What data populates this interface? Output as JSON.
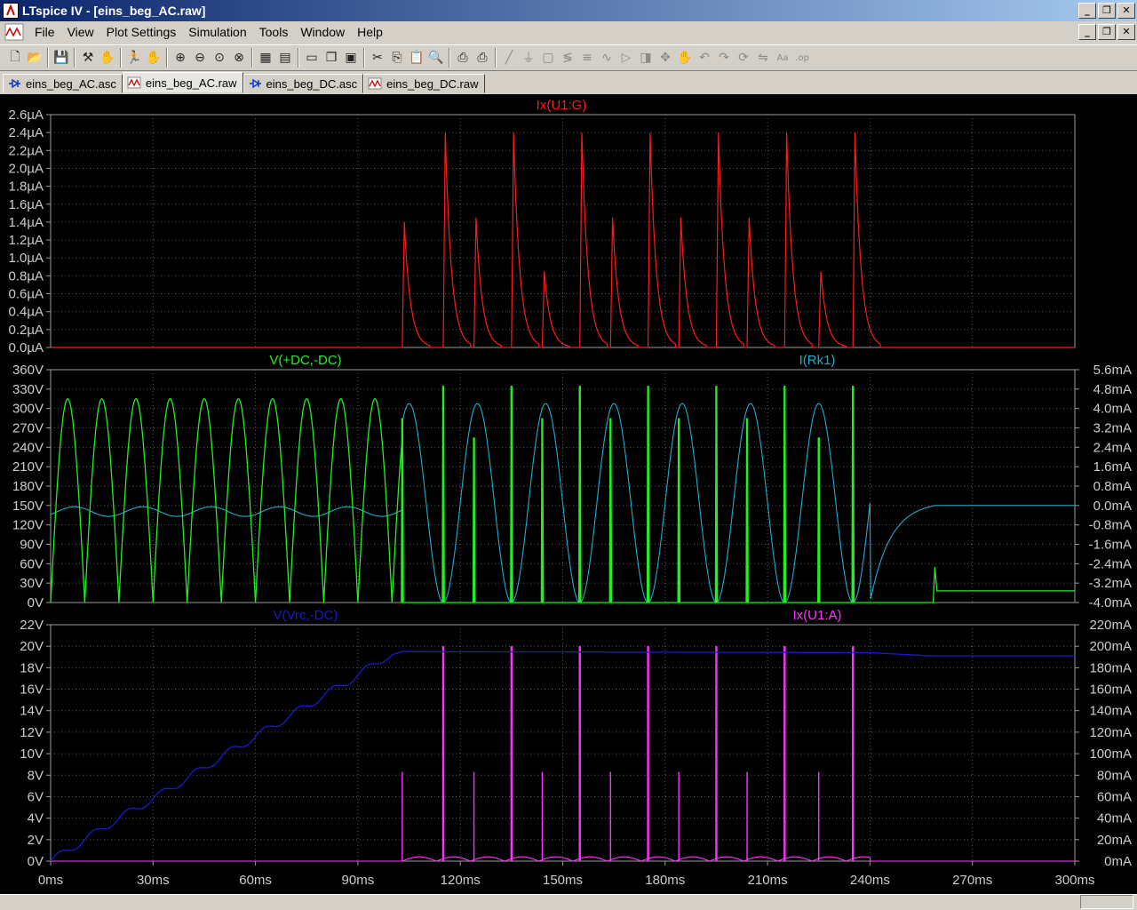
{
  "window": {
    "title": "LTspice IV - [eins_beg_AC.raw]",
    "controls": [
      "minimize",
      "restore",
      "close"
    ]
  },
  "menu": [
    "File",
    "View",
    "Plot Settings",
    "Simulation",
    "Tools",
    "Window",
    "Help"
  ],
  "toolbar": [
    "new-schematic-icon",
    "open-icon",
    "|",
    "save-icon",
    "|",
    "hammer-icon",
    "pan-icon",
    "|",
    "run-icon",
    "halt-icon",
    "|",
    "zoom-in-icon",
    "zoom-out-icon",
    "zoom-fit-icon",
    "zoom-cancel-icon",
    "|",
    "autoscale-icon",
    "tile-icon",
    "|",
    "cascade-icon",
    "tile-vertical-icon",
    "window-icon",
    "|",
    "cut-icon",
    "copy-icon",
    "paste-icon",
    "find-icon",
    "|",
    "print-icon",
    "print-setup-icon",
    "|",
    "wire-icon",
    "ground-icon",
    "label-icon",
    "resistor-icon",
    "capacitor-icon",
    "inductor-icon",
    "diode-icon",
    "component-icon",
    "move-icon",
    "drag-icon",
    "undo-icon",
    "redo-icon",
    "rotate-icon",
    "mirror-icon",
    "text-icon",
    "spice-directive-icon"
  ],
  "tabs": [
    {
      "label": "eins_beg_AC.asc",
      "kind": "schematic",
      "active": false
    },
    {
      "label": "eins_beg_AC.raw",
      "kind": "waveform",
      "active": true
    },
    {
      "label": "eins_beg_DC.asc",
      "kind": "schematic",
      "active": false
    },
    {
      "label": "eins_beg_DC.raw",
      "kind": "waveform",
      "active": false
    }
  ],
  "colors": {
    "background": "#000000",
    "grid": "#5a5a5a",
    "axis_text": "#cccccc",
    "red": "#ff1a1a",
    "green": "#22ee22",
    "cyan": "#22aacc",
    "blue": "#1a1acc",
    "magenta": "#ff33ff"
  },
  "chart_data": [
    {
      "type": "line",
      "title": "",
      "xlim": [
        0,
        300
      ],
      "xunit": "ms",
      "x_ticks": [
        "0ms",
        "30ms",
        "60ms",
        "90ms",
        "120ms",
        "150ms",
        "180ms",
        "210ms",
        "240ms",
        "270ms",
        "300ms"
      ],
      "left_axis": {
        "unit": "µA",
        "ylim": [
          0,
          2.6
        ],
        "ticks": [
          "0.0µA",
          "0.2µA",
          "0.4µA",
          "0.6µA",
          "0.8µA",
          "1.0µA",
          "1.2µA",
          "1.4µA",
          "1.6µA",
          "1.8µA",
          "2.0µA",
          "2.2µA",
          "2.4µA",
          "2.6µA"
        ]
      },
      "series": [
        {
          "name": "Ix(U1:G)",
          "color": "red",
          "axis": "left",
          "pulses": [
            {
              "t": 103,
              "peak": 1.4
            },
            {
              "t": 115,
              "peak": 2.4
            },
            {
              "t": 124,
              "peak": 1.45
            },
            {
              "t": 135,
              "peak": 2.4
            },
            {
              "t": 144,
              "peak": 0.85
            },
            {
              "t": 155,
              "peak": 2.4
            },
            {
              "t": 164,
              "peak": 1.45
            },
            {
              "t": 175,
              "peak": 2.4
            },
            {
              "t": 184,
              "peak": 1.45
            },
            {
              "t": 195,
              "peak": 2.4
            },
            {
              "t": 204,
              "peak": 1.45
            },
            {
              "t": 215,
              "peak": 2.4
            },
            {
              "t": 225,
              "peak": 0.85
            },
            {
              "t": 235,
              "peak": 2.4
            }
          ]
        }
      ]
    },
    {
      "type": "line",
      "title": "",
      "xlim": [
        0,
        300
      ],
      "left_axis": {
        "unit": "V",
        "ylim": [
          0,
          360
        ],
        "ticks": [
          "0V",
          "30V",
          "60V",
          "90V",
          "120V",
          "150V",
          "180V",
          "210V",
          "240V",
          "270V",
          "300V",
          "330V",
          "360V"
        ]
      },
      "right_axis": {
        "unit": "mA",
        "ylim": [
          -4.0,
          5.6
        ],
        "ticks": [
          "-4.0mA",
          "-3.2mA",
          "-2.4mA",
          "-1.6mA",
          "-0.8mA",
          "0.0mA",
          "0.8mA",
          "1.6mA",
          "2.4mA",
          "3.2mA",
          "4.0mA",
          "4.8mA",
          "5.6mA"
        ]
      },
      "series": [
        {
          "name": "V(+DC,-DC)",
          "color": "green",
          "axis": "left",
          "peak": 315,
          "period_ms": 10,
          "pulse_phase_ms": [
            {
              "t": 103,
              "peak": 285
            },
            {
              "t": 115,
              "peak": 335
            },
            {
              "t": 124,
              "peak": 255
            },
            {
              "t": 135,
              "peak": 335
            },
            {
              "t": 144,
              "peak": 285
            },
            {
              "t": 155,
              "peak": 335
            },
            {
              "t": 164,
              "peak": 285
            },
            {
              "t": 175,
              "peak": 335
            },
            {
              "t": 184,
              "peak": 285
            },
            {
              "t": 195,
              "peak": 335
            },
            {
              "t": 204,
              "peak": 285
            },
            {
              "t": 215,
              "peak": 335
            },
            {
              "t": 225,
              "peak": 255
            },
            {
              "t": 235,
              "peak": 335
            }
          ],
          "tail": {
            "t_start": 248,
            "t_step": 259,
            "level_before": 0,
            "level_after": 18
          }
        },
        {
          "name": "I(Rk1)",
          "color": "cyan",
          "axis": "right",
          "before_103ms": {
            "amplitude_mA": 0.2,
            "offset_mA": -0.25,
            "period_ms": 20
          },
          "after_103ms": {
            "amplitude_mA": 4.1,
            "offset_mA": 0.1,
            "period_ms": 20
          },
          "tail": {
            "t_start": 240,
            "t_settle": 259,
            "level_after": 0.0
          }
        }
      ]
    },
    {
      "type": "line",
      "title": "",
      "xlim": [
        0,
        300
      ],
      "left_axis": {
        "unit": "V",
        "ylim": [
          0,
          22
        ],
        "ticks": [
          "0V",
          "2V",
          "4V",
          "6V",
          "8V",
          "10V",
          "12V",
          "14V",
          "16V",
          "18V",
          "20V",
          "22V"
        ]
      },
      "right_axis": {
        "unit": "mA",
        "ylim": [
          0,
          220
        ],
        "ticks": [
          "0mA",
          "20mA",
          "40mA",
          "60mA",
          "80mA",
          "100mA",
          "120mA",
          "140mA",
          "160mA",
          "180mA",
          "200mA",
          "220mA"
        ]
      },
      "series": [
        {
          "name": "V(Vrc,-DC)",
          "color": "blue",
          "axis": "left",
          "points": [
            [
              0,
              0
            ],
            [
              10,
              2.0
            ],
            [
              20,
              4.0
            ],
            [
              30,
              5.8
            ],
            [
              40,
              7.7
            ],
            [
              50,
              9.7
            ],
            [
              60,
              11.6
            ],
            [
              70,
              13.5
            ],
            [
              80,
              15.4
            ],
            [
              90,
              17.3
            ],
            [
              98,
              19.0
            ],
            [
              103,
              19.5
            ],
            [
              240,
              19.4
            ],
            [
              258,
              19.1
            ],
            [
              300,
              19.1
            ]
          ]
        },
        {
          "name": "Ix(U1:A)",
          "color": "magenta",
          "axis": "right",
          "spikes": [
            {
              "t": 103,
              "peak": 83
            },
            {
              "t": 115,
              "peak": 200
            },
            {
              "t": 124,
              "peak": 83
            },
            {
              "t": 135,
              "peak": 200
            },
            {
              "t": 144,
              "peak": 83
            },
            {
              "t": 155,
              "peak": 200
            },
            {
              "t": 164,
              "peak": 83
            },
            {
              "t": 175,
              "peak": 200
            },
            {
              "t": 184,
              "peak": 83
            },
            {
              "t": 195,
              "peak": 200
            },
            {
              "t": 204,
              "peak": 83
            },
            {
              "t": 215,
              "peak": 200
            },
            {
              "t": 225,
              "peak": 83
            },
            {
              "t": 235,
              "peak": 200
            }
          ]
        }
      ]
    }
  ]
}
